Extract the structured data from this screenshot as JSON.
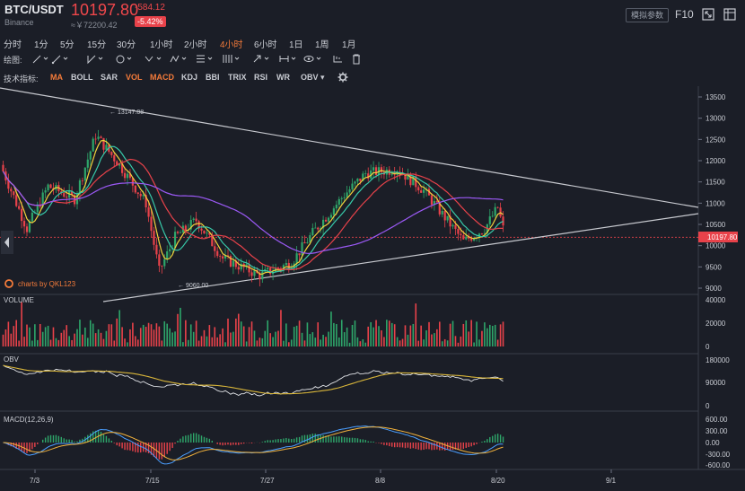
{
  "header": {
    "pair": "BTC/USDT",
    "exchange": "Binance",
    "price": "10197.80",
    "cny": "≈￥72200.42",
    "change": "-584.12",
    "change_pct": "-5.42%",
    "param_button": "模拟参数",
    "f10": "F10"
  },
  "periods": [
    "分时",
    "1分",
    "5分",
    "15分",
    "30分",
    "1小时",
    "2小时",
    "4小时",
    "6小时",
    "1日",
    "1周",
    "1月"
  ],
  "active_period": "4小时",
  "draw_label": "绘图:",
  "indicator_label": "技术指标:",
  "indicators": [
    "MA",
    "BOLL",
    "SAR",
    "VOL",
    "MACD",
    "KDJ",
    "BBI",
    "TRIX",
    "RSI",
    "WR",
    "OBV ▾"
  ],
  "active_indicators": [
    "MA",
    "VOL",
    "MACD"
  ],
  "main_chart": {
    "y_ticks": [
      "13500",
      "13000",
      "12500",
      "12000",
      "11500",
      "11000",
      "10500",
      "10000",
      "9500",
      "9000"
    ],
    "last_price_tag": "10197.80",
    "high_label": "← 13147.08",
    "low_label": "← 9060.00",
    "watermark": "charts by QKL123"
  },
  "volume_panel": {
    "title": "VOLUME",
    "y_ticks": [
      "40000",
      "20000",
      "0"
    ]
  },
  "obv_panel": {
    "title": "OBV",
    "y_ticks": [
      "180000",
      "90000",
      "0"
    ]
  },
  "macd_panel": {
    "title": "MACD(12,26,9)",
    "y_ticks": [
      "600.00",
      "300.00",
      "0.00",
      "-300.00",
      "-600.00"
    ]
  },
  "x_axis": [
    "7/3",
    "7/15",
    "7/27",
    "8/8",
    "8/20",
    "9/1"
  ],
  "colors": {
    "up": "#2ea66a",
    "down": "#e8424a",
    "accent": "#f47b3a",
    "ma5": "#f2d23c",
    "ma10": "#37c9a9",
    "ma20": "#e8424a",
    "ma60": "#9b59f5",
    "obv": "#e2e4e8",
    "obv_ma": "#d9b63a",
    "dif": "#4a9eff",
    "dea": "#f2b23c"
  }
}
